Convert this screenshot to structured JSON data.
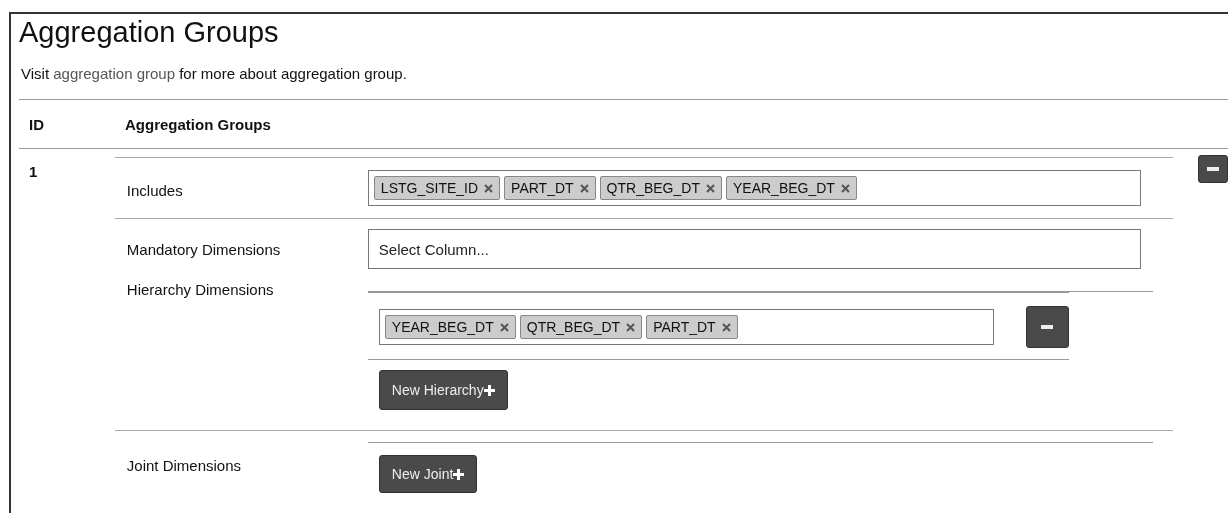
{
  "title": "Aggregation Groups",
  "intro": {
    "before": "Visit ",
    "link": "aggregation group",
    "after": " for more about aggregation group."
  },
  "columns": [
    "ID",
    "Aggregation Groups"
  ],
  "groups": [
    {
      "id": "1",
      "includes": {
        "label": "Includes",
        "tags": [
          "LSTG_SITE_ID",
          "PART_DT",
          "QTR_BEG_DT",
          "YEAR_BEG_DT"
        ]
      },
      "mandatory": {
        "label": "Mandatory Dimensions",
        "placeholder": "Select Column..."
      },
      "hierarchy": {
        "label": "Hierarchy Dimensions",
        "hierarchies": [
          {
            "tags": [
              "YEAR_BEG_DT",
              "QTR_BEG_DT",
              "PART_DT"
            ]
          }
        ],
        "new_button": "New Hierarchy"
      },
      "joint": {
        "label": "Joint Dimensions",
        "new_button": "New Joint"
      }
    }
  ]
}
